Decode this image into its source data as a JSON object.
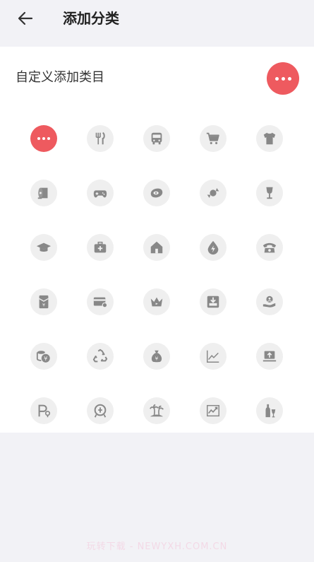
{
  "header": {
    "title": "添加分类",
    "back_icon": "back-arrow-icon"
  },
  "custom": {
    "label": "自定义添加类目",
    "button_icon": "more-icon",
    "accent": "#ee5a5f"
  },
  "icons": [
    {
      "name": "more-icon",
      "selected": true
    },
    {
      "name": "restaurant-icon"
    },
    {
      "name": "bus-icon"
    },
    {
      "name": "shopping-cart-icon"
    },
    {
      "name": "tshirt-icon"
    },
    {
      "name": "tissue-roll-icon"
    },
    {
      "name": "gamepad-icon"
    },
    {
      "name": "meat-icon"
    },
    {
      "name": "candy-icon"
    },
    {
      "name": "wine-glass-icon"
    },
    {
      "name": "graduation-cap-icon"
    },
    {
      "name": "medical-kit-icon"
    },
    {
      "name": "house-icon"
    },
    {
      "name": "water-drop-lightning-icon"
    },
    {
      "name": "telephone-icon"
    },
    {
      "name": "red-envelope-icon"
    },
    {
      "name": "credit-card-icon"
    },
    {
      "name": "crown-icon"
    },
    {
      "name": "inbox-download-icon"
    },
    {
      "name": "hand-person-icon"
    },
    {
      "name": "coins-icon"
    },
    {
      "name": "recycle-icon"
    },
    {
      "name": "money-bag-icon"
    },
    {
      "name": "line-chart-icon"
    },
    {
      "name": "laptop-upload-icon"
    },
    {
      "name": "parking-icon"
    },
    {
      "name": "train-icon"
    },
    {
      "name": "palm-island-icon"
    },
    {
      "name": "stock-chart-icon"
    },
    {
      "name": "bottle-glass-icon"
    }
  ],
  "watermark": "玩转下载 - NEWYXH.COM.CN"
}
